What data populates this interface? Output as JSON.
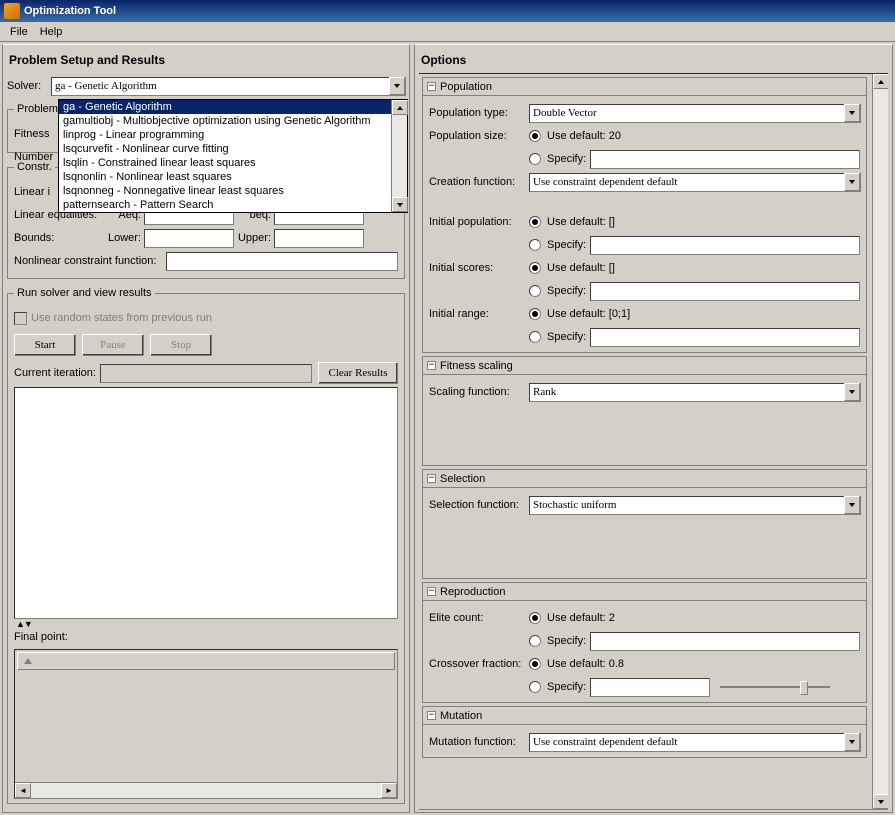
{
  "window": {
    "title": "Optimization Tool"
  },
  "menubar": {
    "file": "File",
    "help": "Help"
  },
  "left": {
    "title": "Problem Setup and Results",
    "solver_label": "Solver:",
    "solver_value": "ga - Genetic Algorithm",
    "dropdown_items": [
      "ga - Genetic Algorithm",
      "gamultiobj - Multiobjective optimization using Genetic Algorithm",
      "linprog - Linear programming",
      "lsqcurvefit - Nonlinear curve fitting",
      "lsqlin - Constrained linear least squares",
      "lsqnonlin - Nonlinear least squares",
      "lsqnonneg - Nonnegative linear least squares",
      "patternsearch - Pattern Search"
    ],
    "problem_legend": "Problem",
    "fitness_label": "Fitness",
    "number_label": "Number",
    "constraints_legend": "Constr.",
    "linear_ineq_label": "Linear i",
    "linear_eq_label": "Linear equalities:",
    "aeq_label": "Aeq:",
    "beq_label": "beq:",
    "bounds_label": "Bounds:",
    "lower_label": "Lower:",
    "upper_label": "Upper:",
    "nlcon_label": "Nonlinear constraint function:",
    "run_legend": "Run solver and view results",
    "use_random_label": "Use random states from previous run",
    "start_btn": "Start",
    "pause_btn": "Pause",
    "stop_btn": "Stop",
    "current_iter_label": "Current iteration:",
    "clear_results_btn": "Clear Results",
    "final_point_label": "Final point:"
  },
  "right": {
    "title": "Options",
    "sections": {
      "population": {
        "head": "Population",
        "pop_type_label": "Population type:",
        "pop_type_value": "Double Vector",
        "pop_size_label": "Population size:",
        "pop_size_default": "Use default: 20",
        "specify": "Specify:",
        "creation_label": "Creation function:",
        "creation_value": "Use constraint dependent default",
        "init_pop_label": "Initial population:",
        "init_pop_default": "Use default: []",
        "init_scores_label": "Initial scores:",
        "init_scores_default": "Use default: []",
        "init_range_label": "Initial range:",
        "init_range_default": "Use default: [0;1]"
      },
      "fitness_scaling": {
        "head": "Fitness scaling",
        "scaling_label": "Scaling function:",
        "scaling_value": "Rank"
      },
      "selection": {
        "head": "Selection",
        "sel_label": "Selection function:",
        "sel_value": "Stochastic uniform"
      },
      "reproduction": {
        "head": "Reproduction",
        "elite_label": "Elite count:",
        "elite_default": "Use default: 2",
        "crossover_label": "Crossover fraction:",
        "crossover_default": "Use default: 0.8"
      },
      "mutation": {
        "head": "Mutation",
        "mutation_label": "Mutation function:",
        "mutation_value": "Use constraint dependent default"
      }
    }
  }
}
